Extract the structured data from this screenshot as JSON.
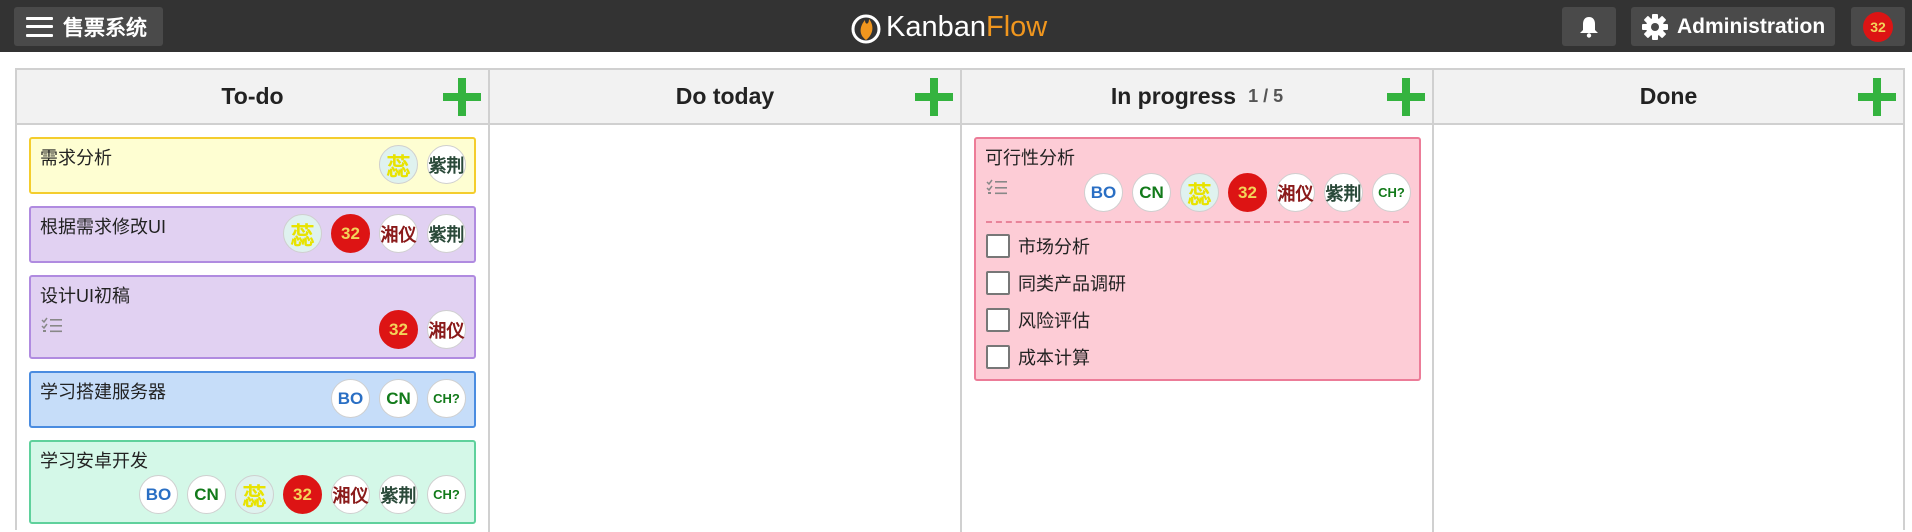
{
  "topbar": {
    "board_name": "售票系统",
    "logo": {
      "part1": "Kanban",
      "part2": "Flow"
    },
    "admin_label": "Administration",
    "user_avatar": "32"
  },
  "columns": [
    {
      "name": "To-do",
      "wip": ""
    },
    {
      "name": "Do today",
      "wip": ""
    },
    {
      "name": "In progress",
      "wip": "1 / 5"
    },
    {
      "name": "Done",
      "wip": ""
    }
  ],
  "tasks": [
    {
      "title": "需求分析",
      "color": "#fefed2",
      "border": "#f4cd2d",
      "avatars": [
        {
          "t": "蕊",
          "c": "rui"
        },
        {
          "t": "紫荆",
          "c": "zi"
        }
      ]
    },
    {
      "title": "根据需求修改UI",
      "color": "#e1d1f2",
      "border": "#b08be0",
      "avatars": [
        {
          "t": "蕊",
          "c": "rui"
        },
        {
          "t": "32",
          "c": "n32"
        },
        {
          "t": "湘仪",
          "c": "xiang"
        },
        {
          "t": "紫荆",
          "c": "zi"
        }
      ]
    },
    {
      "title": "设计UI初稿",
      "color": "#e1d1f2",
      "border": "#b08be0",
      "avatars": [
        {
          "t": "32",
          "c": "n32"
        },
        {
          "t": "湘仪",
          "c": "xiang"
        }
      ]
    },
    {
      "title": "学习搭建服务器",
      "color": "#c6ddf9",
      "border": "#4a8ce0",
      "avatars": [
        {
          "t": "BO",
          "c": "bo"
        },
        {
          "t": "CN",
          "c": "cn"
        },
        {
          "t": "CH?",
          "c": "ch"
        }
      ]
    },
    {
      "title": "学习安卓开发",
      "color": "#d4f8e8",
      "border": "#5fd19c",
      "avatars": [
        {
          "t": "BO",
          "c": "bo"
        },
        {
          "t": "CN",
          "c": "cn"
        },
        {
          "t": "蕊",
          "c": "rui"
        },
        {
          "t": "32",
          "c": "n32"
        },
        {
          "t": "湘仪",
          "c": "xiang"
        },
        {
          "t": "紫荆",
          "c": "zi"
        },
        {
          "t": "CH?",
          "c": "ch"
        }
      ]
    }
  ],
  "progress_task": {
    "title": "可行性分析",
    "color": "#fdccd6",
    "border": "#ec7c98",
    "avatars": [
      {
        "t": "BO",
        "c": "bo"
      },
      {
        "t": "CN",
        "c": "cn"
      },
      {
        "t": "蕊",
        "c": "rui"
      },
      {
        "t": "32",
        "c": "n32"
      },
      {
        "t": "湘仪",
        "c": "xiang"
      },
      {
        "t": "紫荆",
        "c": "zi"
      },
      {
        "t": "CH?",
        "c": "ch"
      }
    ],
    "checklist": [
      "市场分析",
      "同类产品调研",
      "风险评估",
      "成本计算"
    ]
  }
}
